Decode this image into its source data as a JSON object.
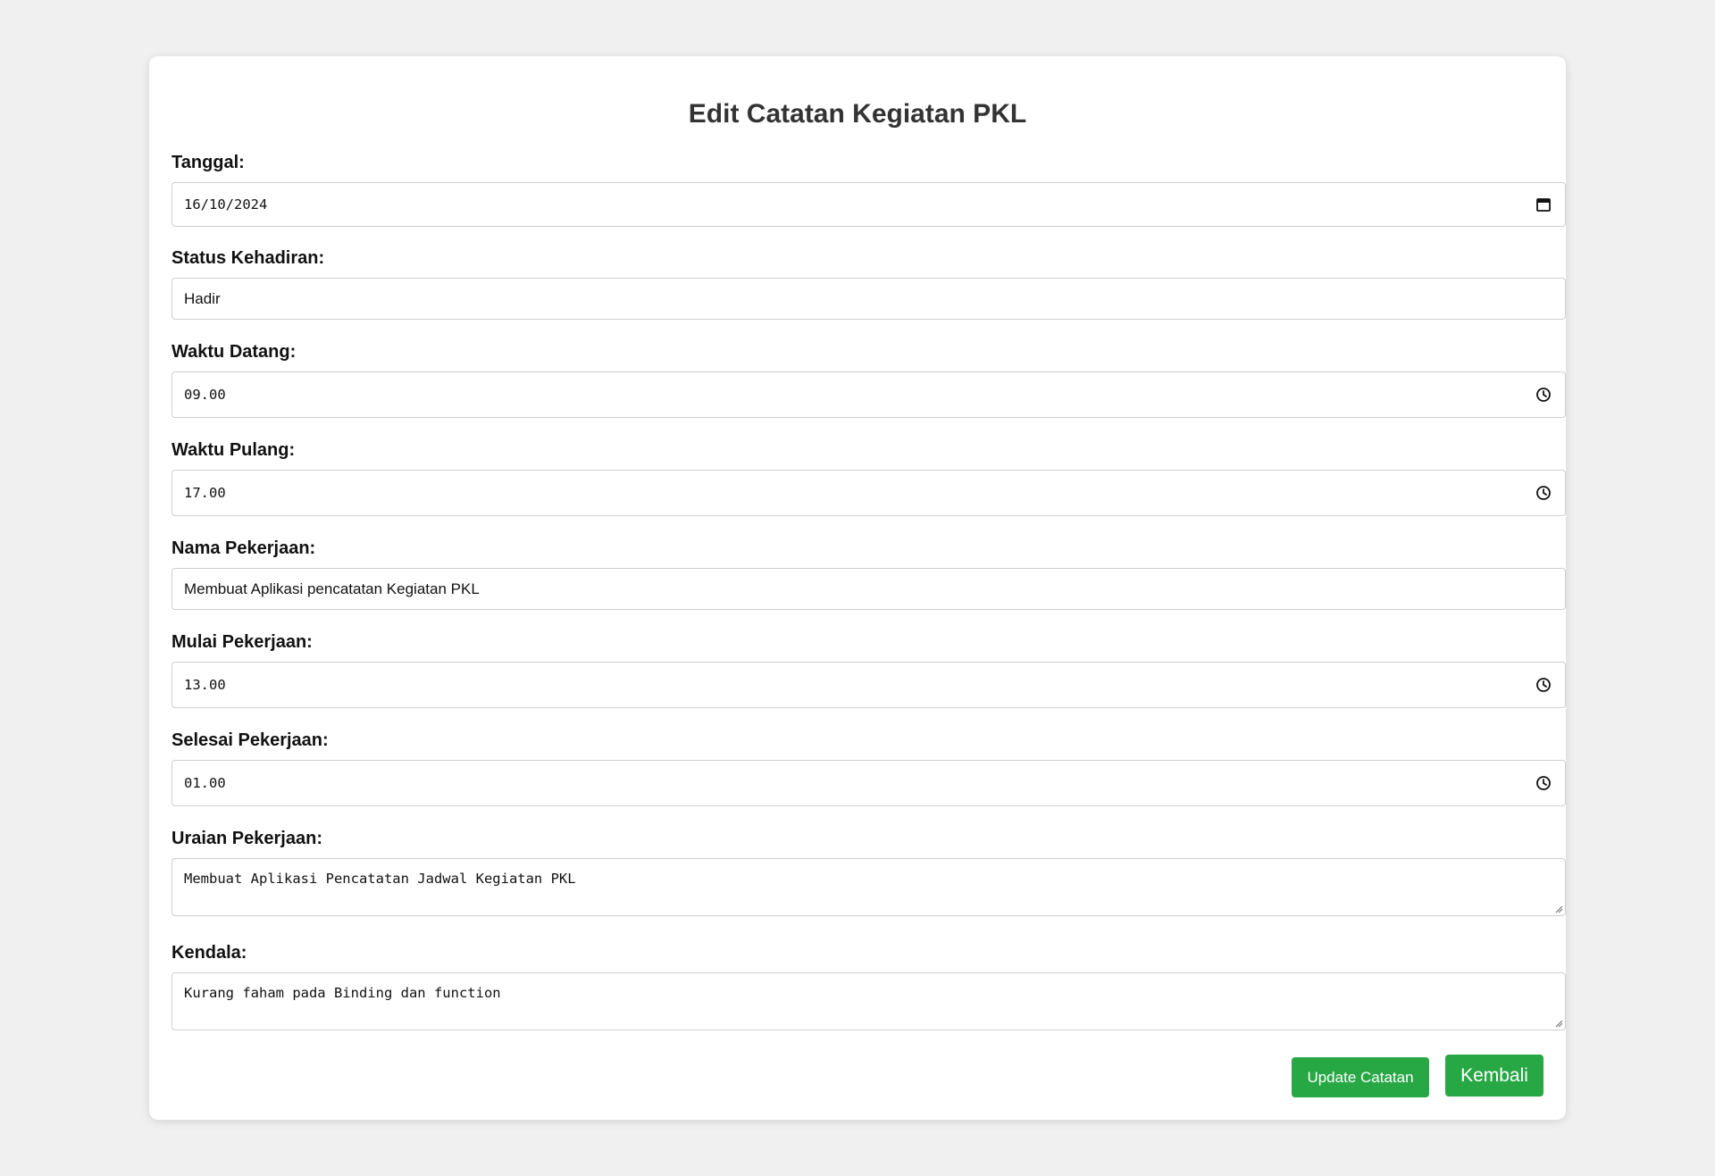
{
  "form": {
    "title": "Edit Catatan Kegiatan PKL",
    "fields": {
      "tanggal": {
        "label": "Tanggal:",
        "value": "16/10/2024",
        "icon": "calendar-icon"
      },
      "status": {
        "label": "Status Kehadiran:",
        "value": "Hadir"
      },
      "waktu_datang": {
        "label": "Waktu Datang:",
        "value": "09.00",
        "icon": "clock-icon"
      },
      "waktu_pulang": {
        "label": "Waktu Pulang:",
        "value": "17.00",
        "icon": "clock-icon"
      },
      "nama_pekerjaan": {
        "label": "Nama Pekerjaan:",
        "value": "Membuat Aplikasi pencatatan Kegiatan PKL"
      },
      "mulai_pekerjaan": {
        "label": "Mulai Pekerjaan:",
        "value": "13.00",
        "icon": "clock-icon"
      },
      "selesai_pekerjaan": {
        "label": "Selesai Pekerjaan:",
        "value": "01.00",
        "icon": "clock-icon"
      },
      "uraian_pekerjaan": {
        "label": "Uraian Pekerjaan:",
        "value": "Membuat Aplikasi Pencatatan Jadwal Kegiatan PKL"
      },
      "kendala": {
        "label": "Kendala:",
        "value": "Kurang faham pada Binding dan function"
      }
    },
    "buttons": {
      "update": "Update Catatan",
      "back": "Kembali"
    }
  },
  "colors": {
    "background": "#f0f0f0",
    "card": "#ffffff",
    "button": "#28a745",
    "field_border": "#cfcfcf"
  }
}
